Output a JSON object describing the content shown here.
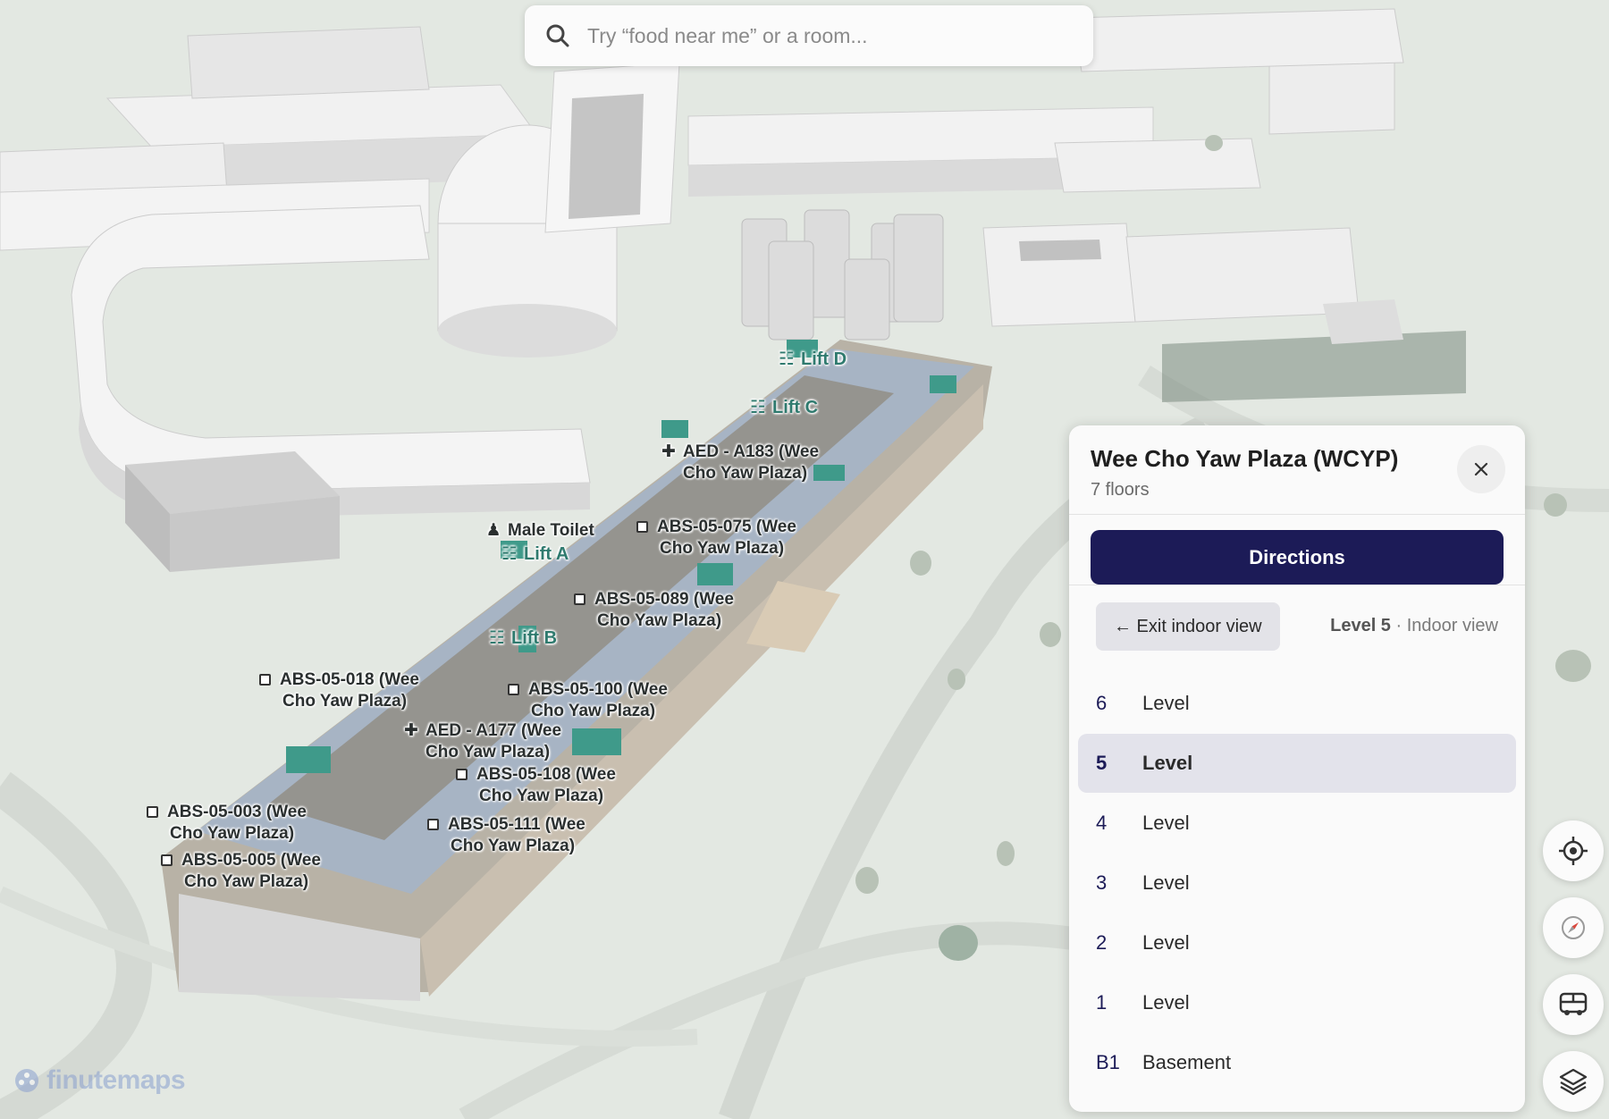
{
  "search": {
    "placeholder": "Try “food near me” or a room..."
  },
  "map": {
    "labels": {
      "lift_d": "Lift D",
      "lift_c": "Lift C",
      "lift_a": "Lift A",
      "lift_b": "Lift B",
      "male_toilet": "Male Toilet",
      "aed_a183": [
        "AED - A183 (Wee",
        "Cho Yaw Plaza)"
      ],
      "abs_05_075": [
        "ABS-05-075 (Wee",
        "Cho Yaw Plaza)"
      ],
      "abs_05_089": [
        "ABS-05-089 (Wee",
        "Cho Yaw Plaza)"
      ],
      "abs_05_018": [
        "ABS-05-018 (Wee",
        "Cho Yaw Plaza)"
      ],
      "abs_05_100": [
        "ABS-05-100 (Wee",
        "Cho Yaw Plaza)"
      ],
      "aed_a177": [
        "AED - A177 (Wee",
        "Cho Yaw Plaza)"
      ],
      "abs_05_108": [
        "ABS-05-108 (Wee",
        "Cho Yaw Plaza)"
      ],
      "abs_05_003": [
        "ABS-05-003 (Wee",
        "Cho Yaw Plaza)"
      ],
      "abs_05_111": [
        "ABS-05-111 (Wee",
        "Cho Yaw Plaza)"
      ],
      "abs_05_005": [
        "ABS-05-005 (Wee",
        "Cho Yaw Plaza)"
      ]
    }
  },
  "panel": {
    "title": "Wee Cho Yaw Plaza (WCYP)",
    "subtitle": "7 floors",
    "directions_label": "Directions",
    "exit_label": "← Exit indoor view",
    "current_level": "Level 5",
    "view_mode": "· Indoor view",
    "floors": [
      {
        "num": "6",
        "name": "Level",
        "active": false
      },
      {
        "num": "5",
        "name": "Level",
        "active": true
      },
      {
        "num": "4",
        "name": "Level",
        "active": false
      },
      {
        "num": "3",
        "name": "Level",
        "active": false
      },
      {
        "num": "2",
        "name": "Level",
        "active": false
      },
      {
        "num": "1",
        "name": "Level",
        "active": false
      },
      {
        "num": "B1",
        "name": "Basement",
        "active": false
      }
    ]
  },
  "controls": {
    "icons": [
      "locate-icon",
      "compass-icon",
      "bus-icon",
      "layers-icon"
    ]
  },
  "logo": {
    "text": "finutemaps"
  },
  "colors": {
    "primary": "#1c1b57",
    "lift_teal": "#2f7a6e",
    "map_bg": "#e4e8e3"
  }
}
